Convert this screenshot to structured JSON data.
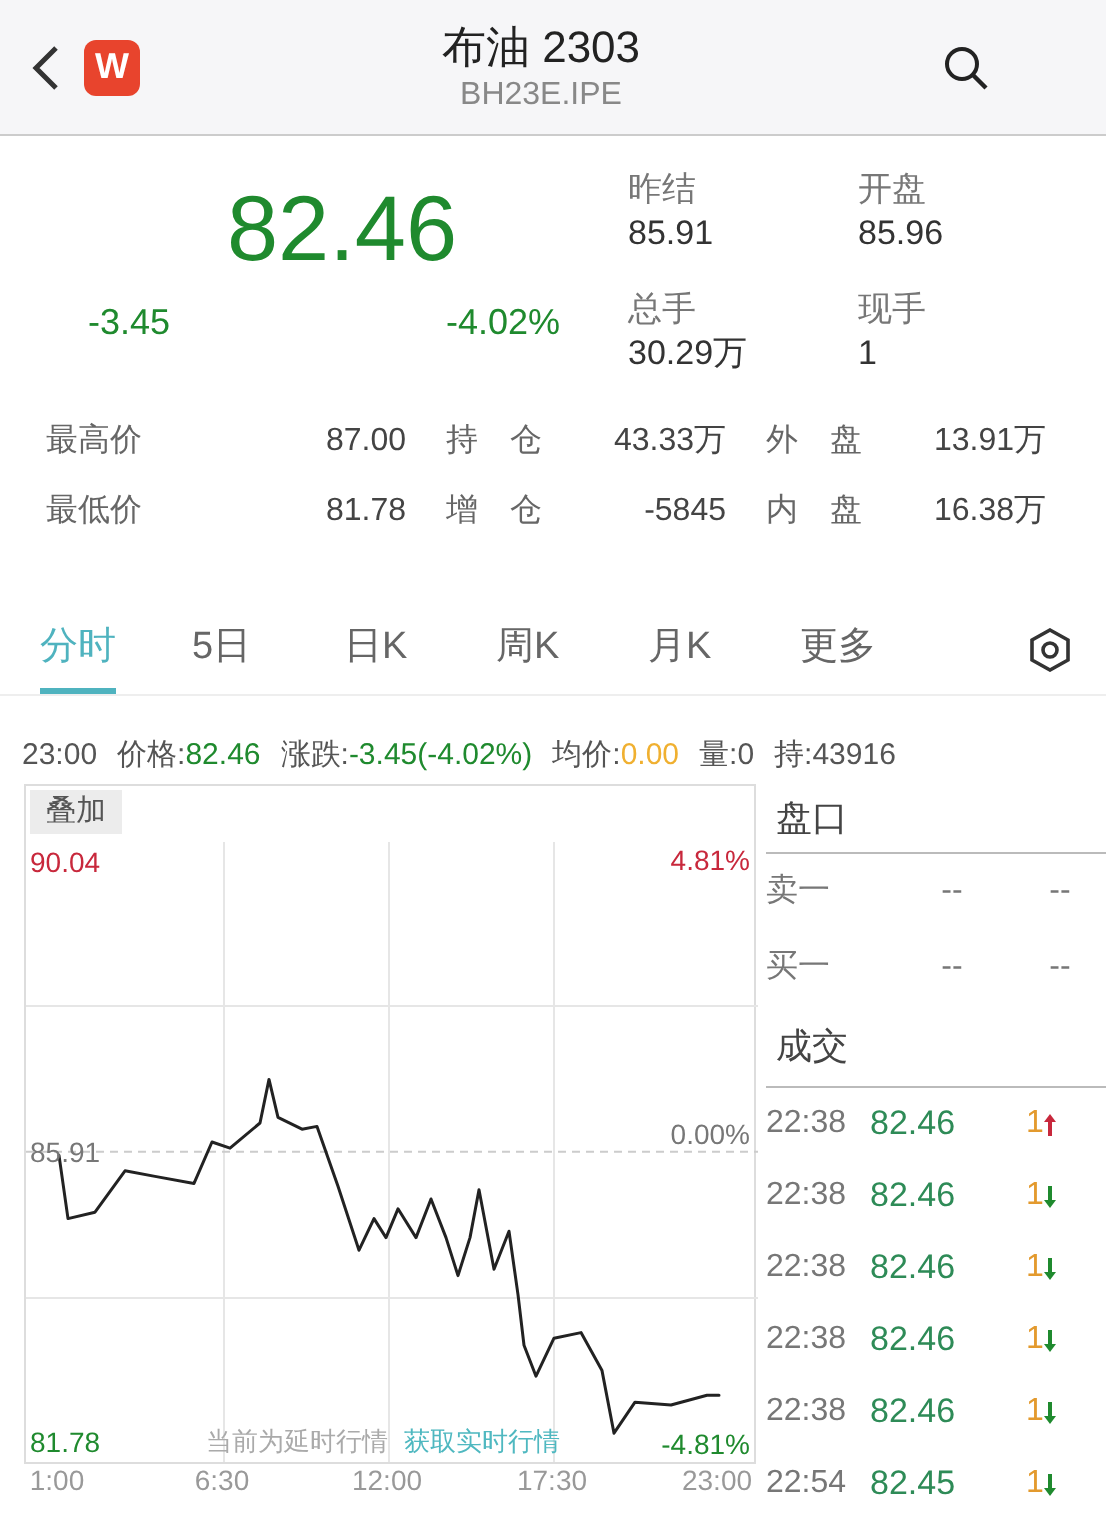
{
  "header": {
    "title": "布油 2303",
    "subtitle": "BH23E.IPE",
    "logo": "W"
  },
  "quote": {
    "price": "82.46",
    "change": "-3.45",
    "change_pct": "-4.02%"
  },
  "quote_fields": [
    {
      "label": "昨结",
      "value": "85.91"
    },
    {
      "label": "开盘",
      "value": "85.96"
    },
    {
      "label": "总手",
      "value": "30.29万"
    },
    {
      "label": "现手",
      "value": "1"
    }
  ],
  "stats": [
    [
      {
        "label": "最高价",
        "value": "87.00"
      },
      {
        "label": "持　仓",
        "value": "43.33万"
      },
      {
        "label": "外　盘",
        "value": "13.91万"
      }
    ],
    [
      {
        "label": "最低价",
        "value": "81.78"
      },
      {
        "label": "增　仓",
        "value": "-5845"
      },
      {
        "label": "内　盘",
        "value": "16.38万"
      }
    ]
  ],
  "tabs": [
    {
      "label": "分时",
      "selected": true
    },
    {
      "label": "5日",
      "selected": false
    },
    {
      "label": "日K",
      "selected": false
    },
    {
      "label": "周K",
      "selected": false
    },
    {
      "label": "月K",
      "selected": false
    },
    {
      "label": "更多",
      "selected": false
    }
  ],
  "info_bar": [
    {
      "label": "23:00"
    },
    {
      "label": "价格:",
      "value": "82.46",
      "kind": "down"
    },
    {
      "label": "涨跌:",
      "value": "-3.45(-4.02%)",
      "kind": "down"
    },
    {
      "label": "均价:",
      "value": "0.00",
      "kind": "avg"
    },
    {
      "label": "量:0"
    },
    {
      "label": "持:43916"
    }
  ],
  "chart": {
    "overlay_button": "叠加",
    "pct_labels": [
      "4.81%",
      "0.00%",
      "-4.81%"
    ],
    "delay_note": "当前为延时行情",
    "realtime_link": "获取实时行情",
    "chart_data": {
      "type": "line",
      "xlim": [
        -0.1,
        24.3
      ],
      "ylim": [
        81.5,
        91.11
      ],
      "xticks": [
        {
          "value": 1,
          "label": "1:00"
        },
        {
          "value": 6.5,
          "label": "6:30"
        },
        {
          "value": 12,
          "label": "12:00"
        },
        {
          "value": 17.5,
          "label": "17:30"
        },
        {
          "value": 23,
          "label": "23:00"
        }
      ],
      "yticks": [
        {
          "value": 81.78,
          "label": "81.78"
        },
        {
          "value": 85.91,
          "label": "85.91"
        },
        {
          "value": 90.04,
          "label": "90.04"
        }
      ],
      "ref_lines": [
        {
          "axis": "y",
          "value": 85.91
        }
      ],
      "grid": true,
      "x": [
        1,
        1.3,
        2.2,
        3.2,
        4.2,
        5.5,
        6.1,
        6.7,
        7.7,
        8.0,
        8.3,
        9.1,
        9.6,
        10.3,
        11.0,
        11.5,
        11.9,
        12.3,
        12.9,
        13.4,
        13.9,
        14.3,
        14.7,
        15.0,
        15.5,
        16.0,
        16.3,
        16.5,
        16.9,
        17.5,
        18.4,
        19.1,
        19.5,
        20.2,
        21.4,
        22.6,
        23.0
      ],
      "series": [
        {
          "color": "#222222",
          "values": [
            85.86,
            84.96,
            85.05,
            85.64,
            85.56,
            85.46,
            86.05,
            85.96,
            86.32,
            86.94,
            86.4,
            86.23,
            86.27,
            85.42,
            84.51,
            84.96,
            84.69,
            85.1,
            84.69,
            85.24,
            84.69,
            84.15,
            84.69,
            85.37,
            84.24,
            84.78,
            83.88,
            83.16,
            82.72,
            83.26,
            83.34,
            82.8,
            81.91,
            82.35,
            82.31,
            82.45,
            82.45
          ]
        }
      ]
    }
  },
  "order_book": {
    "title": "盘口",
    "rows": [
      {
        "label": "卖一",
        "price": "--",
        "volume": "--"
      },
      {
        "label": "买一",
        "price": "--",
        "volume": "--"
      }
    ]
  },
  "trades": {
    "title": "成交",
    "rows": [
      {
        "time": "22:38",
        "price": "82.46",
        "volume": "1",
        "kind": "up"
      },
      {
        "time": "22:38",
        "price": "82.46",
        "volume": "1",
        "kind": "down"
      },
      {
        "time": "22:38",
        "price": "82.46",
        "volume": "1",
        "kind": "down"
      },
      {
        "time": "22:38",
        "price": "82.46",
        "volume": "1",
        "kind": "down"
      },
      {
        "time": "22:38",
        "price": "82.46",
        "volume": "1",
        "kind": "down"
      },
      {
        "time": "22:54",
        "price": "82.45",
        "volume": "1",
        "kind": "down"
      }
    ]
  }
}
